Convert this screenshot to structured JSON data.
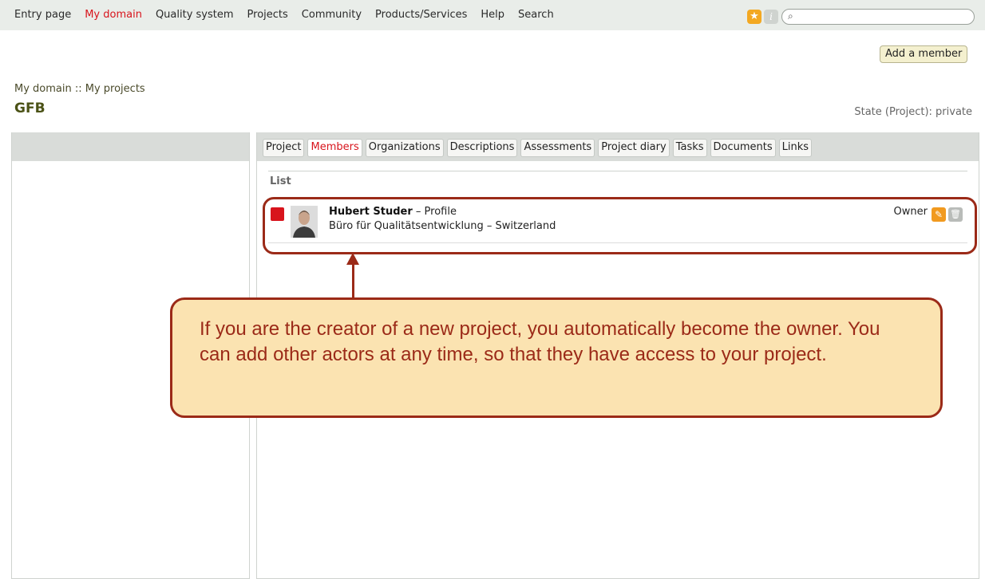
{
  "topnav": {
    "items": [
      {
        "label": "Entry page",
        "active": false
      },
      {
        "label": "My domain",
        "active": true
      },
      {
        "label": "Quality system",
        "active": false
      },
      {
        "label": "Projects",
        "active": false
      },
      {
        "label": "Community",
        "active": false
      },
      {
        "label": "Products/Services",
        "active": false
      },
      {
        "label": "Help",
        "active": false
      },
      {
        "label": "Search",
        "active": false
      }
    ],
    "star_icon": "star-icon",
    "info_icon": "info-icon",
    "search_placeholder": ""
  },
  "toolbar": {
    "add_member_label": "Add a member"
  },
  "breadcrumb": "My domain :: My projects",
  "page_title": "GFB",
  "state": "State (Project): private",
  "tabs": [
    {
      "label": "Project",
      "active": false
    },
    {
      "label": "Members",
      "active": true
    },
    {
      "label": "Organizations",
      "active": false
    },
    {
      "label": "Descriptions",
      "active": false
    },
    {
      "label": "Assessments",
      "active": false
    },
    {
      "label": "Project diary",
      "active": false
    },
    {
      "label": "Tasks",
      "active": false
    },
    {
      "label": "Documents",
      "active": false
    },
    {
      "label": "Links",
      "active": false
    }
  ],
  "list": {
    "label": "List",
    "members": [
      {
        "name": "Hubert Studer",
        "separator": " – ",
        "profile_label": "Profile",
        "organization": "Büro für Qualitätsentwicklung – Switzerland",
        "role": "Owner"
      }
    ]
  },
  "callout": {
    "text": "If you are the creator of a new project, you automatically become the owner. You can add other actors at any time, so that they have access to your project."
  },
  "colors": {
    "accent_red": "#d8141c",
    "annotation_border": "#9b2a18",
    "callout_fill": "#fbe3b1"
  }
}
